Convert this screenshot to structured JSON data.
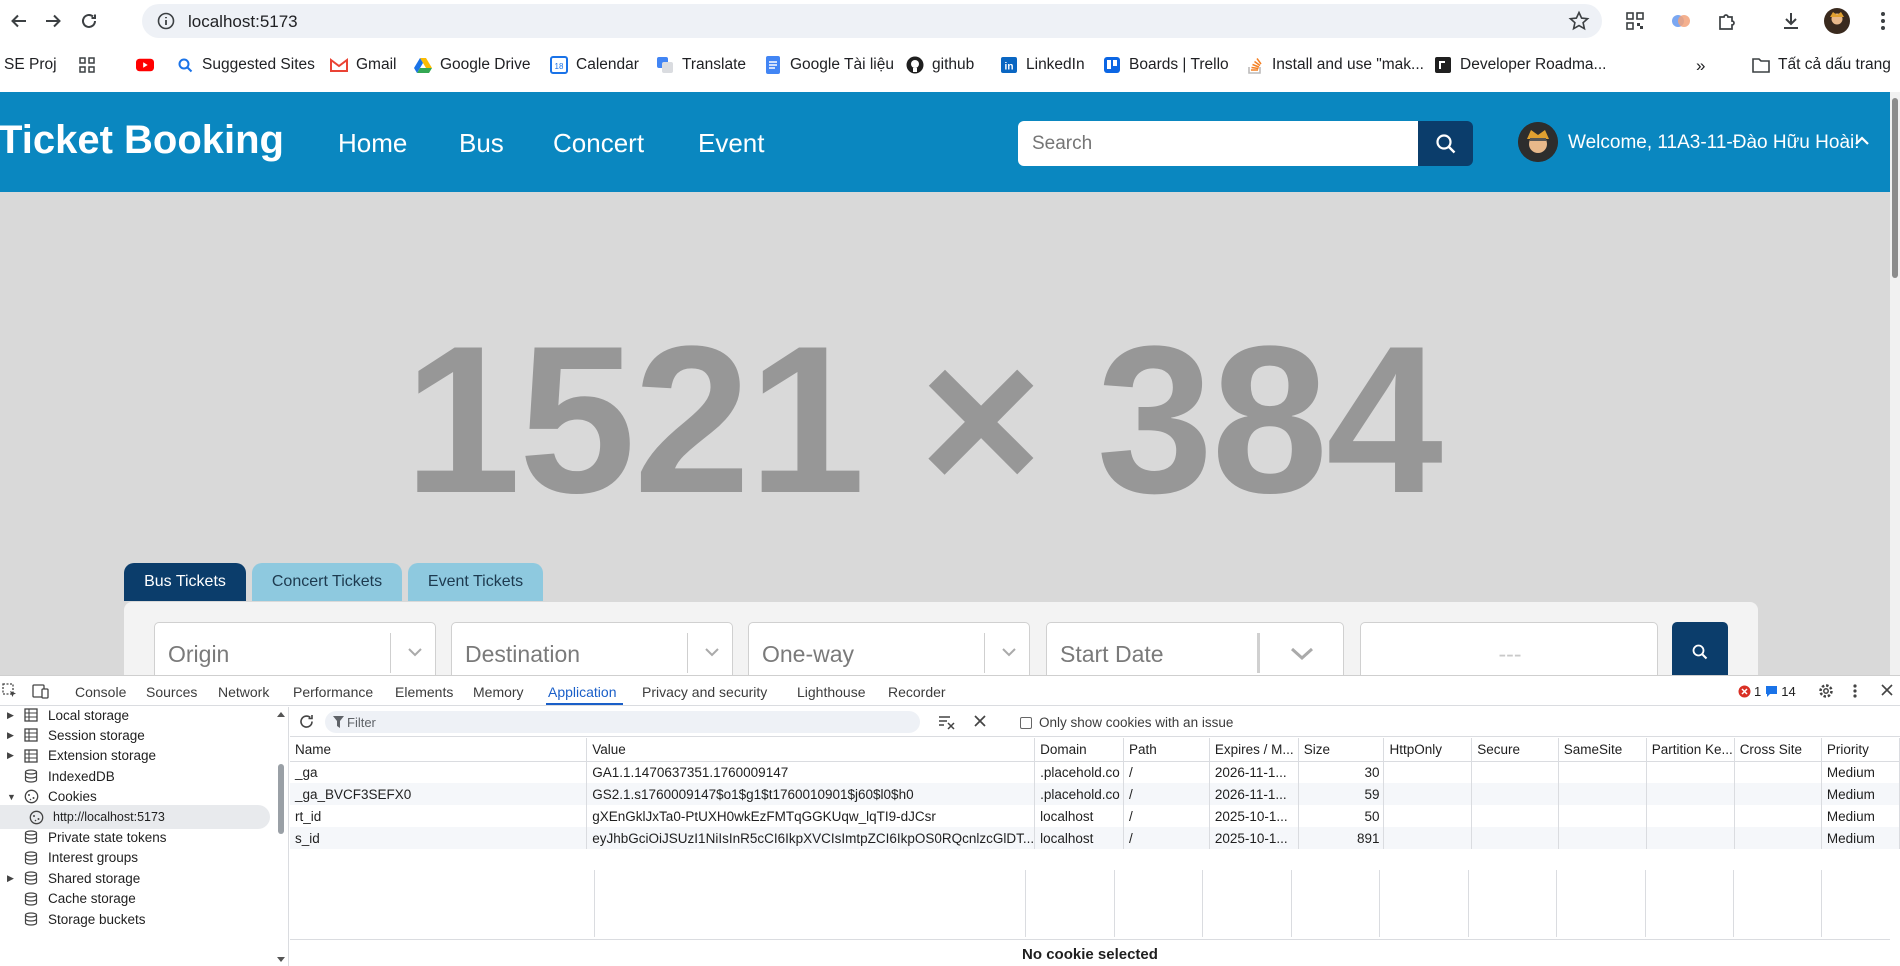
{
  "browser": {
    "url": "localhost:5173",
    "bookmarks": [
      {
        "label": "SE Proj",
        "icon": "folder-icon"
      },
      {
        "label": "",
        "icon": "apps-grid-icon"
      },
      {
        "label": "",
        "icon": "youtube-icon"
      },
      {
        "label": "Suggested Sites",
        "icon": "search-icon"
      },
      {
        "label": "Gmail",
        "icon": "gmail-icon"
      },
      {
        "label": "Google Drive",
        "icon": "drive-icon"
      },
      {
        "label": "Calendar",
        "icon": "calendar-icon"
      },
      {
        "label": "Translate",
        "icon": "translate-icon"
      },
      {
        "label": "Google Tài liệu",
        "icon": "docs-icon"
      },
      {
        "label": "github",
        "icon": "github-icon"
      },
      {
        "label": "LinkedIn",
        "icon": "linkedin-icon"
      },
      {
        "label": "Boards | Trello",
        "icon": "trello-icon"
      },
      {
        "label": "Install and use \"mak...",
        "icon": "stackoverflow-icon"
      },
      {
        "label": "Developer Roadma...",
        "icon": "roadmap-icon"
      }
    ],
    "all_bookmarks_label": "Tất cả dấu trang",
    "accent": "#1a73e8"
  },
  "site": {
    "brand": "Ticket Booking",
    "nav": [
      "Home",
      "Bus",
      "Concert",
      "Event"
    ],
    "search_placeholder": "Search",
    "welcome": "Welcome, 11A3-11-Đào Hữu Hoài!",
    "hero_placeholder": "1521 × 384",
    "ticket_tabs": [
      "Bus Tickets",
      "Concert Tickets",
      "Event Tickets"
    ],
    "fields": {
      "origin": "Origin",
      "destination": "Destination",
      "trip_type": "One-way",
      "start_date": "Start Date",
      "return_date": "---"
    },
    "colors": {
      "navbar": "#0a87c0",
      "dark": "#0b3d6b",
      "tab_inactive": "#8ec9df",
      "page_bg": "#d9d9d9"
    }
  },
  "devtools": {
    "tabs": [
      "Console",
      "Sources",
      "Network",
      "Performance",
      "Elements",
      "Memory",
      "Application",
      "Privacy and security",
      "Lighthouse",
      "Recorder"
    ],
    "active_tab": "Application",
    "errors": "1",
    "messages": "14",
    "sidebar": [
      {
        "label": "Local storage",
        "icon": "grid-icon",
        "expandable": true
      },
      {
        "label": "Session storage",
        "icon": "grid-icon",
        "expandable": true
      },
      {
        "label": "Extension storage",
        "icon": "grid-icon",
        "expandable": true
      },
      {
        "label": "IndexedDB",
        "icon": "database-icon",
        "expandable": false
      },
      {
        "label": "Cookies",
        "icon": "cookie-icon",
        "expandable": true,
        "expanded": true
      },
      {
        "label": "http://localhost:5173",
        "icon": "cookie-icon",
        "child": true,
        "selected": true
      },
      {
        "label": "Private state tokens",
        "icon": "database-icon",
        "expandable": false
      },
      {
        "label": "Interest groups",
        "icon": "database-icon",
        "expandable": false
      },
      {
        "label": "Shared storage",
        "icon": "database-icon",
        "expandable": true
      },
      {
        "label": "Cache storage",
        "icon": "database-icon",
        "expandable": false
      },
      {
        "label": "Storage buckets",
        "icon": "database-icon",
        "expandable": false
      }
    ],
    "filter_placeholder": "Filter",
    "only_issue_label": "Only show cookies with an issue",
    "columns": [
      "Name",
      "Value",
      "Domain",
      "Path",
      "Expires / M...",
      "Size",
      "HttpOnly",
      "Secure",
      "SameSite",
      "Partition Ke...",
      "Cross Site",
      "Priority"
    ],
    "cookies": [
      {
        "name": "_ga",
        "value": "GA1.1.1470637351.1760009147",
        "domain": ".placehold.co",
        "path": "/",
        "expires": "2026-11-1...",
        "size": "30",
        "priority": "Medium"
      },
      {
        "name": "_ga_BVCF3SEFX0",
        "value": "GS2.1.s1760009147$o1$g1$t1760010901$j60$l0$h0",
        "domain": ".placehold.co",
        "path": "/",
        "expires": "2026-11-1...",
        "size": "59",
        "priority": "Medium"
      },
      {
        "name": "rt_id",
        "value": "gXEnGklJxTa0-PtUXH0wkEzFMTqGGKUqw_lqTI9-dJCsr",
        "domain": "localhost",
        "path": "/",
        "expires": "2025-10-1...",
        "size": "50",
        "priority": "Medium"
      },
      {
        "name": "s_id",
        "value": "eyJhbGciOiJSUzI1NiIsInR5cCI6IkpXVCIsImtpZCI6IkpOS0RQcnlzcGlDT...",
        "domain": "localhost",
        "path": "/",
        "expires": "2025-10-1...",
        "size": "891",
        "priority": "Medium"
      }
    ],
    "no_selection": "No cookie selected"
  }
}
